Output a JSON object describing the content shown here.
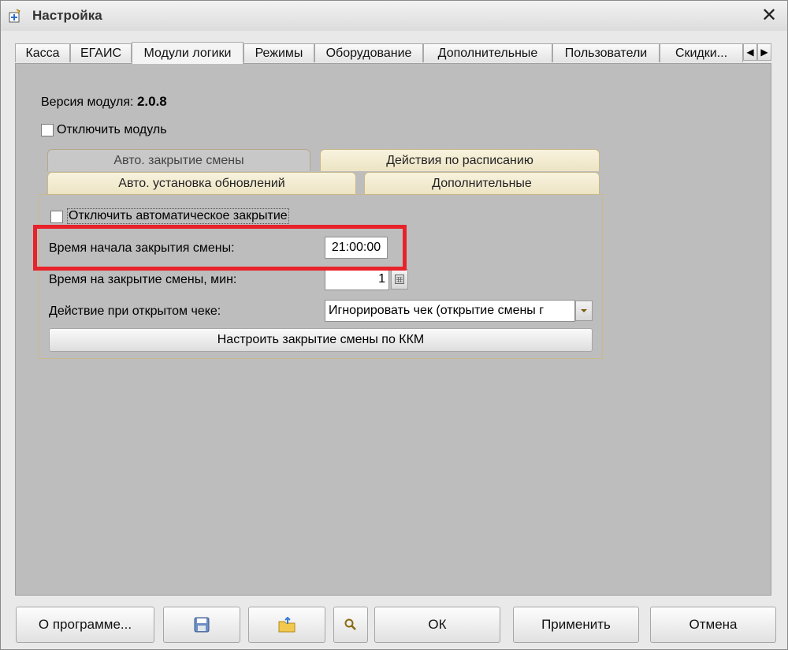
{
  "window": {
    "title": "Настройка"
  },
  "tabs": [
    {
      "label": "Касса"
    },
    {
      "label": "ЕГАИС"
    },
    {
      "label": "Модули логики"
    },
    {
      "label": "Режимы"
    },
    {
      "label": "Оборудование"
    },
    {
      "label": "Дополнительные"
    },
    {
      "label": "Пользователи"
    },
    {
      "label": "Скидки..."
    }
  ],
  "module": {
    "version_label": "Версия модуля:",
    "version_value": "2.0.8",
    "disable_label": "Отключить модуль"
  },
  "inner_tabs": {
    "back_left": "Авто. закрытие смены",
    "back_right": "Действия по расписанию",
    "front_left": "Авто. установка обновлений",
    "front_right": "Дополнительные"
  },
  "auto_close": {
    "disable_label": "Отключить автоматическое закрытие",
    "start_time_label": "Время начала закрытия смены:",
    "start_time_value": "21:00:00",
    "duration_label": "Время на закрытие смены, мин:",
    "duration_value": "1",
    "open_receipt_label": "Действие при открытом чеке:",
    "open_receipt_value": "Игнорировать чек (открытие смены г",
    "configure_button": "Настроить закрытие смены по ККМ"
  },
  "bottom": {
    "about": "О программе...",
    "ok": "ОК",
    "apply": "Применить",
    "cancel": "Отмена"
  },
  "colors": {
    "highlight": "#e8222a",
    "panel_bg": "#bdbdbd"
  }
}
